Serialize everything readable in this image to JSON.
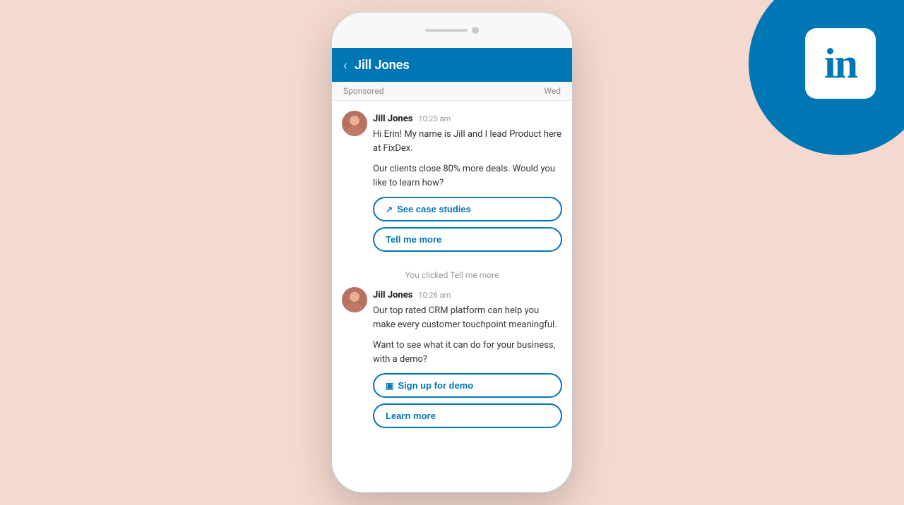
{
  "background_color": "#f5d9ce",
  "linkedin": {
    "logo_text": "in",
    "brand_color": "#0077b5"
  },
  "phone": {
    "header": {
      "back_label": "‹",
      "contact_name": "Jill Jones"
    },
    "sponsored_bar": {
      "label": "Sponsored",
      "day": "Wed"
    },
    "messages": [
      {
        "id": "msg1",
        "sender": "Jill Jones",
        "time": "10:25 am",
        "paragraphs": [
          "Hi Erin! My name is Jill and I lead Product here at FixDex.",
          "Our clients close 80% more deals. Would you like to learn how?"
        ],
        "buttons": [
          {
            "id": "btn-case-studies",
            "icon": "↗",
            "label": "See case studies"
          },
          {
            "id": "btn-tell-more",
            "icon": "",
            "label": "Tell me more"
          }
        ]
      },
      {
        "id": "clicked-status",
        "text": "You clicked Tell me more"
      },
      {
        "id": "msg2",
        "sender": "Jill Jones",
        "time": "10:26 am",
        "paragraphs": [
          "Our top rated CRM platform can help you make every customer touchpoint meaningful.",
          "Want to see what it can do for your business, with a demo?"
        ],
        "buttons": [
          {
            "id": "btn-sign-up",
            "icon": "▣",
            "label": "Sign up for demo"
          },
          {
            "id": "btn-learn-more",
            "icon": "",
            "label": "Learn more"
          }
        ]
      }
    ]
  }
}
